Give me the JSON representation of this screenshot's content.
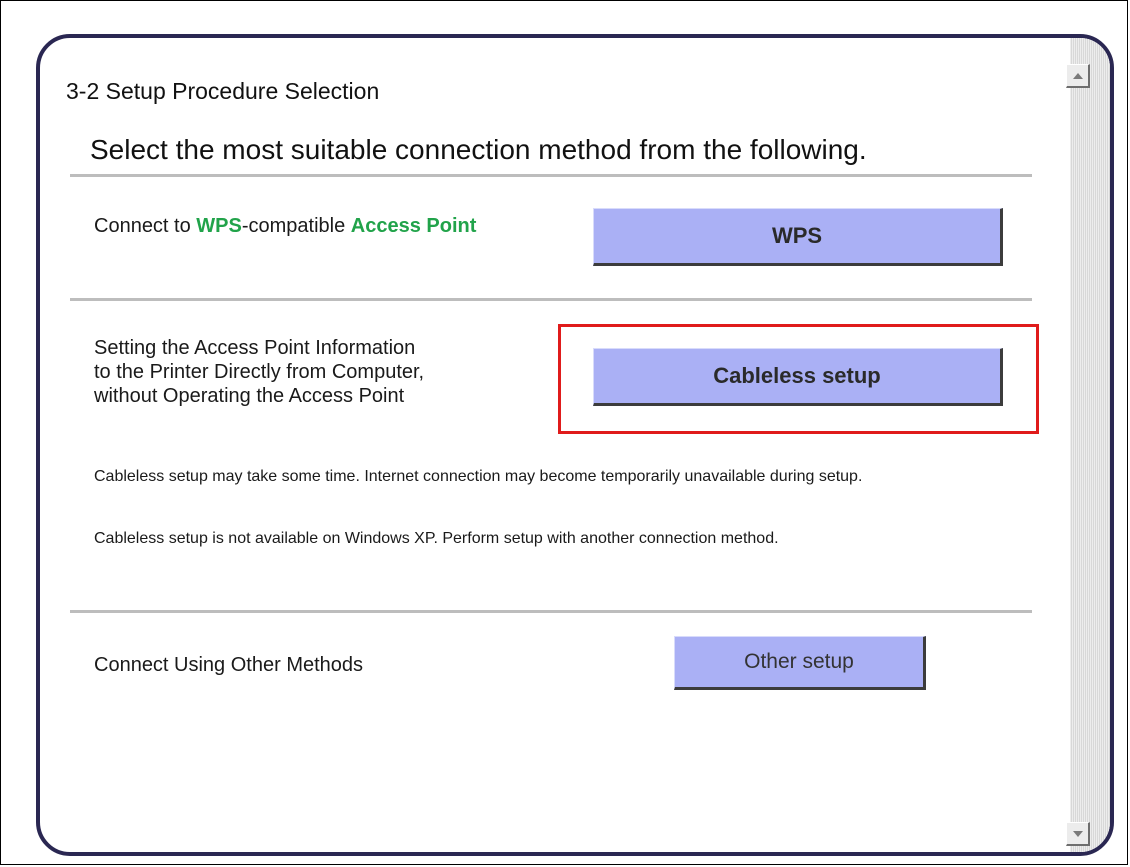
{
  "section_title": "3-2 Setup Procedure Selection",
  "instruction": "Select the most suitable connection method from the following.",
  "rows": {
    "wps": {
      "text_part1": "Connect to ",
      "text_hl1": "WPS",
      "text_part2": "-compatible ",
      "text_hl2": "Access Point",
      "button_label": "WPS"
    },
    "cableless": {
      "line1": "Setting the Access Point Information",
      "line2": "to the Printer Directly from Computer,",
      "line3": "without Operating the Access Point",
      "button_label": "Cableless setup",
      "note1": "Cableless setup may take some time. Internet connection may become temporarily unavailable during setup.",
      "note2": "Cableless setup is not available on Windows XP. Perform setup with another connection method."
    },
    "other": {
      "text": "Connect Using Other Methods",
      "button_label": "Other setup"
    }
  },
  "icons": {
    "scroll_up": "arrow-up-icon",
    "scroll_down": "arrow-down-icon"
  },
  "colors": {
    "accent_green": "#21a34a",
    "button_fill": "#aab0f5",
    "highlight_red": "#e01b1b",
    "panel_border": "#2a2752"
  }
}
